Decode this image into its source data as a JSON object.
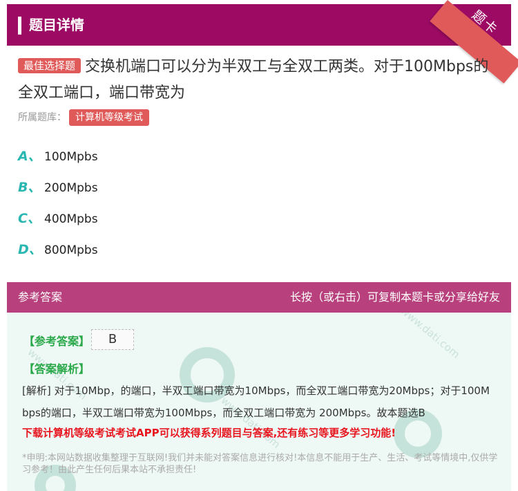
{
  "header": {
    "title": "题目详情"
  },
  "ribbon": {
    "label": "题卡"
  },
  "question": {
    "type_tag": "最佳选择题",
    "text": "交换机端口可以分为半双工与全双工两类。对于100Mbps的全双工端口，端口带宽为",
    "source_label": "所属题库：",
    "source_tag": "计算机等级考试"
  },
  "options": [
    {
      "letter": "A、",
      "text": "100Mpbs"
    },
    {
      "letter": "B、",
      "text": "200Mpbs"
    },
    {
      "letter": "C、",
      "text": "400Mpbs"
    },
    {
      "letter": "D、",
      "text": "800Mpbs"
    }
  ],
  "answer": {
    "section_title": "参考答案",
    "share_hint": "长按（或右击）可复制本题卡或分享给好友",
    "label": "【参考答案】",
    "value": "B",
    "explanation_label": "【答案解析】",
    "explanation": "[解析] 对于10Mbp，的端口，半双工端口带宽为10Mbps，而全双工端口带宽为20Mbps；对于100Mbps的端口，半双工端口带宽为100Mbps，而全双工端口带宽为 200Mbps。故本题选B",
    "promo": "下载计算机等级考试考试APP可以获得系列题目与答案,还有练习等更多学习功能!",
    "disclaimer": "*申明:本网站数据收集整理于互联网!我们并未能对答案信息进行核对!本信息不能用于生产、生活、考试等情境中,仅供学习参考！由此产生任何后果本站不承担责任!"
  },
  "colors": {
    "header_bg": "#9c0a63",
    "answer_header_bg": "#b8417d",
    "accent_red": "#e05a5a",
    "option_letter": "#2ab7b1",
    "answer_green": "#2aa84a"
  }
}
